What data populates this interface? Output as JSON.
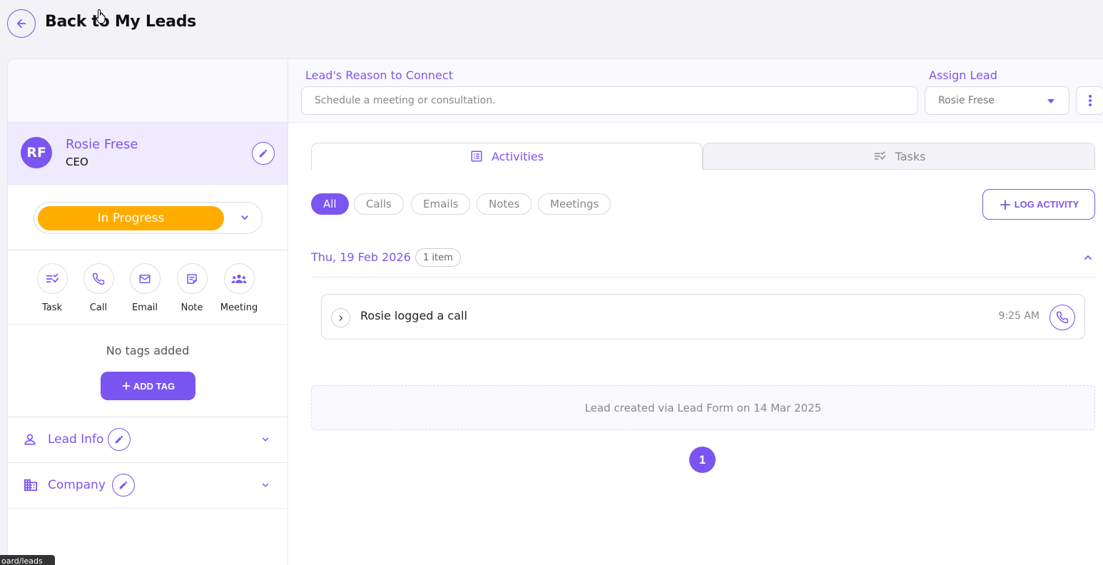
{
  "header": {
    "title": "Back to My Leads"
  },
  "profile": {
    "initials": "RF",
    "name": "Rosie Frese",
    "role": "CEO"
  },
  "status": {
    "label": "In Progress",
    "color": "#ffac00"
  },
  "quick_actions": [
    {
      "label": "Task",
      "icon": "task-list-icon"
    },
    {
      "label": "Call",
      "icon": "phone-icon"
    },
    {
      "label": "Email",
      "icon": "mail-icon"
    },
    {
      "label": "Note",
      "icon": "note-icon"
    },
    {
      "label": "Meeting",
      "icon": "group-icon"
    }
  ],
  "tags": {
    "empty_text": "No tags added",
    "add_label": "ADD TAG"
  },
  "sections": [
    {
      "label": "Lead Info",
      "icon": "person-icon"
    },
    {
      "label": "Company",
      "icon": "building-icon"
    }
  ],
  "tooltip": "oard/leads",
  "reason": {
    "label": "Lead's Reason to Connect",
    "placeholder": "Schedule a meeting or consultation."
  },
  "assign": {
    "label": "Assign Lead",
    "value": "Rosie Frese"
  },
  "tabs": [
    {
      "label": "Activities",
      "active": true
    },
    {
      "label": "Tasks",
      "active": false
    }
  ],
  "filters": [
    "All",
    "Calls",
    "Emails",
    "Notes",
    "Meetings"
  ],
  "log_activity_label": "LOG ACTIVITY",
  "group": {
    "date": "Thu, 19 Feb 2026",
    "count": "1 item"
  },
  "activities": [
    {
      "text": "Rosie logged a call",
      "time": "9:25 AM",
      "icon": "phone-icon"
    }
  ],
  "created_note": "Lead created via Lead Form on 14 Mar 2025",
  "pagination": {
    "current": "1"
  },
  "colors": {
    "accent": "#7b55f0",
    "status": "#ffac00"
  }
}
